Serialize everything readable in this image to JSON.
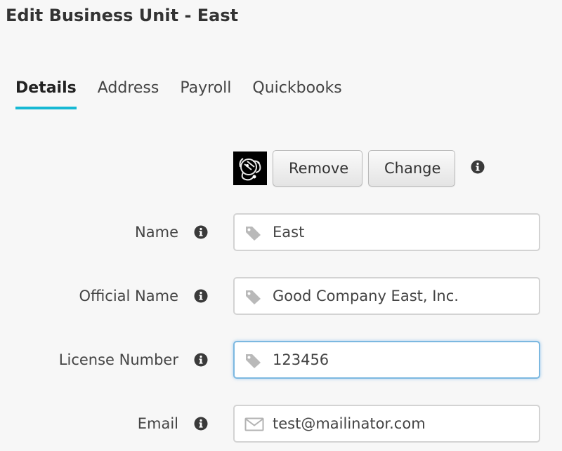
{
  "page": {
    "title": "Edit Business Unit - East"
  },
  "tabs": [
    {
      "label": "Details",
      "active": true
    },
    {
      "label": "Address",
      "active": false
    },
    {
      "label": "Payroll",
      "active": false
    },
    {
      "label": "Quickbooks",
      "active": false
    }
  ],
  "logo": {
    "remove_label": "Remove",
    "change_label": "Change",
    "info_icon": "info-circle-icon"
  },
  "fields": {
    "name": {
      "label": "Name",
      "value": "East",
      "icon": "tag-icon"
    },
    "official_name": {
      "label": "Official Name",
      "value": "Good Company East, Inc.",
      "icon": "tag-icon"
    },
    "license_number": {
      "label": "License Number",
      "value": "123456",
      "icon": "tag-icon",
      "focused": true
    },
    "email": {
      "label": "Email",
      "value": "test@mailinator.com",
      "icon": "envelope-icon"
    }
  },
  "colors": {
    "accent": "#17b9d4",
    "focus_border": "#7cb8e0",
    "background": "#f7f7f7"
  }
}
